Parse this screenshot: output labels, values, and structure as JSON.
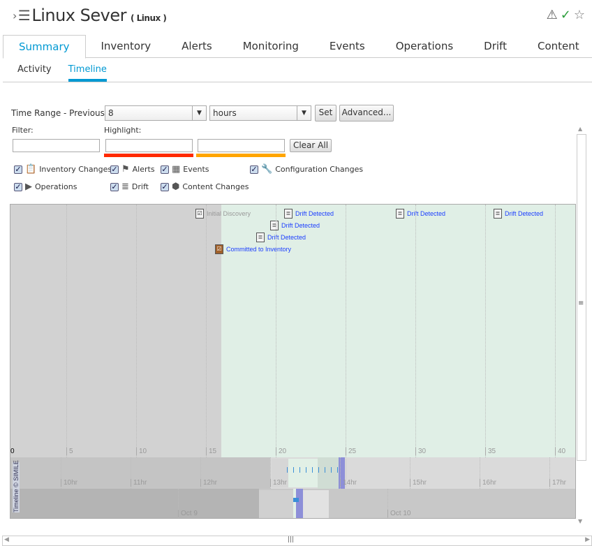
{
  "header": {
    "title": "Linux Sever",
    "subtitle": "( Linux )",
    "icons": [
      "chevron-right-icon",
      "server-icon",
      "warning-icon",
      "check-circle-icon",
      "star-icon"
    ],
    "colors": {
      "accent": "#0099d3",
      "ok": "#2a9d3a"
    }
  },
  "tabs": [
    {
      "label": "Summary",
      "active": true
    },
    {
      "label": "Inventory"
    },
    {
      "label": "Alerts"
    },
    {
      "label": "Monitoring"
    },
    {
      "label": "Events"
    },
    {
      "label": "Operations"
    },
    {
      "label": "Drift"
    },
    {
      "label": "Content"
    }
  ],
  "subtabs": [
    {
      "label": "Activity"
    },
    {
      "label": "Timeline",
      "active": true
    }
  ],
  "controls": {
    "time_range_label": "Time Range - Previous :",
    "amount": "8",
    "unit": "hours",
    "set": "Set",
    "advanced": "Advanced...",
    "filter_label": "Filter:",
    "highlight_label": "Highlight:",
    "filter_value": "",
    "highlight1_value": "",
    "highlight2_value": "",
    "clear_all": "Clear All",
    "highlight_colors": [
      "#ff2a00",
      "#ffa500"
    ]
  },
  "checkboxes": [
    {
      "label": "Inventory Changes",
      "checked": true
    },
    {
      "label": "Alerts",
      "checked": true
    },
    {
      "label": "Events",
      "checked": true
    },
    {
      "label": "Configuration Changes",
      "checked": true
    },
    {
      "label": "Operations",
      "checked": true
    },
    {
      "label": "Drift",
      "checked": true
    },
    {
      "label": "Content Changes",
      "checked": true
    }
  ],
  "timeline": {
    "events": [
      {
        "label": "Initial Discovery"
      },
      {
        "label": "Drift Detected"
      },
      {
        "label": "Drift Detected"
      },
      {
        "label": "Drift Detected"
      },
      {
        "label": "Committed to Inventory"
      },
      {
        "label": "Drift Detected"
      },
      {
        "label": "Drift Detected"
      }
    ],
    "main_ticks": [
      "0",
      "5",
      "10",
      "15",
      "20",
      "25",
      "30",
      "35",
      "40"
    ],
    "hour_ticks": [
      "10hr",
      "11hr",
      "12hr",
      "13hr",
      "14hr",
      "15hr",
      "16hr",
      "17hr"
    ],
    "day_ticks": [
      "Oct 9",
      "Oct 10"
    ],
    "credit": "Timeline © SIMILE"
  }
}
